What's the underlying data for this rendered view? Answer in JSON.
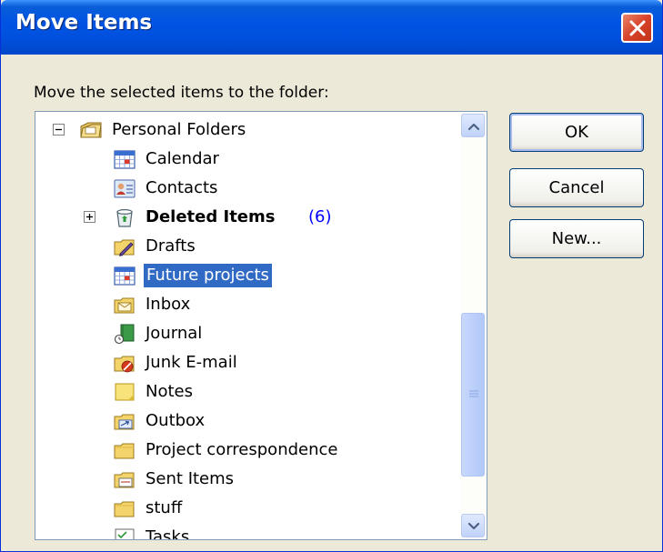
{
  "window": {
    "title": "Move Items"
  },
  "prompt": "Move the selected items to the folder:",
  "tree": {
    "root_label": "Personal Folders",
    "deleted_items_label": "Deleted Items",
    "deleted_items_count": "(6)",
    "items": [
      {
        "label": "Calendar",
        "icon": "calendar-icon"
      },
      {
        "label": "Contacts",
        "icon": "contacts-icon"
      },
      {
        "label": "Deleted Items",
        "icon": "deleted-items-icon"
      },
      {
        "label": "Drafts",
        "icon": "drafts-icon"
      },
      {
        "label": "Future projects",
        "icon": "calendar-icon",
        "selected": true
      },
      {
        "label": "Inbox",
        "icon": "inbox-icon"
      },
      {
        "label": "Journal",
        "icon": "journal-icon"
      },
      {
        "label": "Junk E-mail",
        "icon": "junk-email-icon"
      },
      {
        "label": "Notes",
        "icon": "notes-icon"
      },
      {
        "label": "Outbox",
        "icon": "outbox-icon"
      },
      {
        "label": "Project correspondence",
        "icon": "folder-icon"
      },
      {
        "label": "Sent Items",
        "icon": "sent-items-icon"
      },
      {
        "label": "stuff",
        "icon": "folder-icon"
      },
      {
        "label": "Tasks",
        "icon": "tasks-icon"
      }
    ]
  },
  "buttons": {
    "ok": "OK",
    "cancel": "Cancel",
    "new": "New..."
  },
  "colors": {
    "titlebar": "#0054e3",
    "selection": "#316ac5",
    "count": "#0000ff"
  }
}
